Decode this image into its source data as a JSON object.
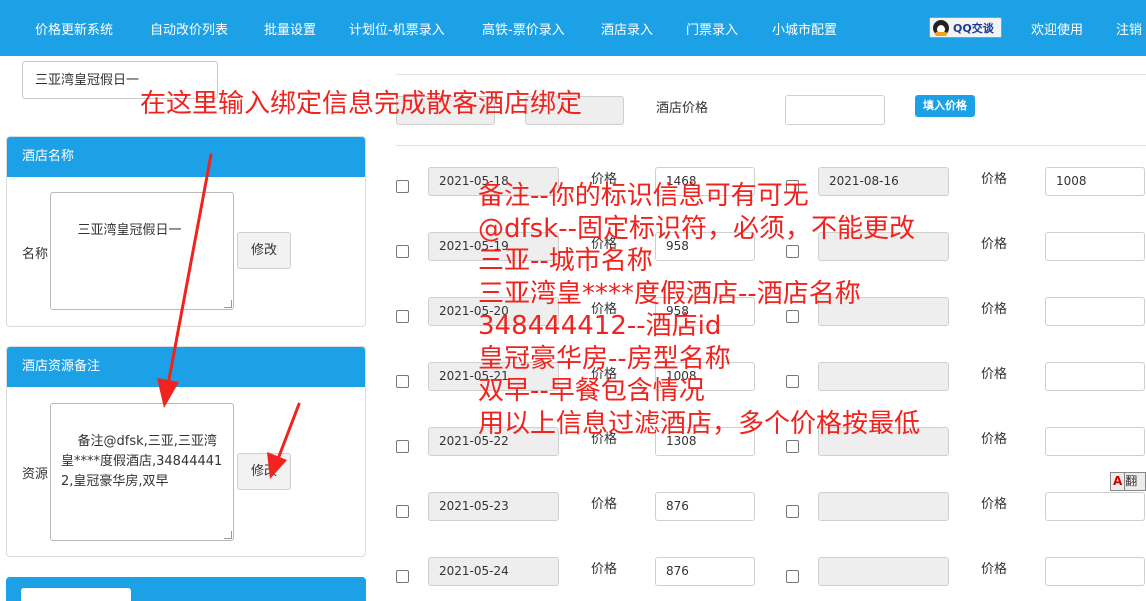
{
  "nav": {
    "items": [
      "价格更新系统",
      "自动改价列表",
      "批量设置",
      "计划位-机票录入",
      "高铁-票价录入",
      "酒店录入",
      "门票录入",
      "小城市配置"
    ],
    "qq_label": "QQ交谈",
    "welcome": "欢迎使用",
    "logout_partial": "注销"
  },
  "left": {
    "top_input_value": "三亚湾皇冠假日一",
    "hotel_name_panel": {
      "title": "酒店名称",
      "label": "名称",
      "value": "三亚湾皇冠假日一",
      "button": "修改"
    },
    "resource_panel": {
      "title": "酒店资源备注",
      "label": "资源",
      "value": "备注@dfsk,三亚,三亚湾皇****度假酒店,348444412,皇冠豪华房,双早",
      "button": "修改"
    }
  },
  "price_header": {
    "label": "酒店价格",
    "input_value": "",
    "fill_button": "填入价格"
  },
  "rows": [
    {
      "date": "2021-05-18",
      "price_label": "价格",
      "price": "1468",
      "right_date": "2021-08-16",
      "right_price_label": "价格",
      "right_price": "1008"
    },
    {
      "date": "2021-05-19",
      "price_label": "价格",
      "price": "958",
      "right_date": "",
      "right_price_label": "价格",
      "right_price": ""
    },
    {
      "date": "2021-05-20",
      "price_label": "价格",
      "price": "958",
      "right_date": "",
      "right_price_label": "价格",
      "right_price": ""
    },
    {
      "date": "2021-05-21",
      "price_label": "价格",
      "price": "1008",
      "right_date": "",
      "right_price_label": "价格",
      "right_price": ""
    },
    {
      "date": "2021-05-22",
      "price_label": "价格",
      "price": "1308",
      "right_date": "",
      "right_price_label": "价格",
      "right_price": ""
    },
    {
      "date": "2021-05-23",
      "price_label": "价格",
      "price": "876",
      "right_date": "",
      "right_price_label": "价格",
      "right_price": ""
    },
    {
      "date": "2021-05-24",
      "price_label": "价格",
      "price": "876",
      "right_date": "",
      "right_price_label": "价格",
      "right_price": ""
    }
  ],
  "annotations": {
    "title": "在这里输入绑定信息完成散客酒店绑定",
    "lines": [
      "备注--你的标识信息可有可无",
      "@dfsk--固定标识符，必须，不能更改",
      "三亚--城市名称",
      "三亚湾皇****度假酒店--酒店名称",
      "348444412--酒店id",
      "皇冠豪华房--房型名称",
      "双早--早餐包含情况",
      "用以上信息过滤酒店，多个价格按最低"
    ],
    "color": "#f0231e"
  },
  "translate_tool": {
    "glyph": "A",
    "label": "翻"
  },
  "colors": {
    "nav_bg": "#1da1e6",
    "panel_header": "#1da1e6",
    "annotation": "#f0231e"
  }
}
